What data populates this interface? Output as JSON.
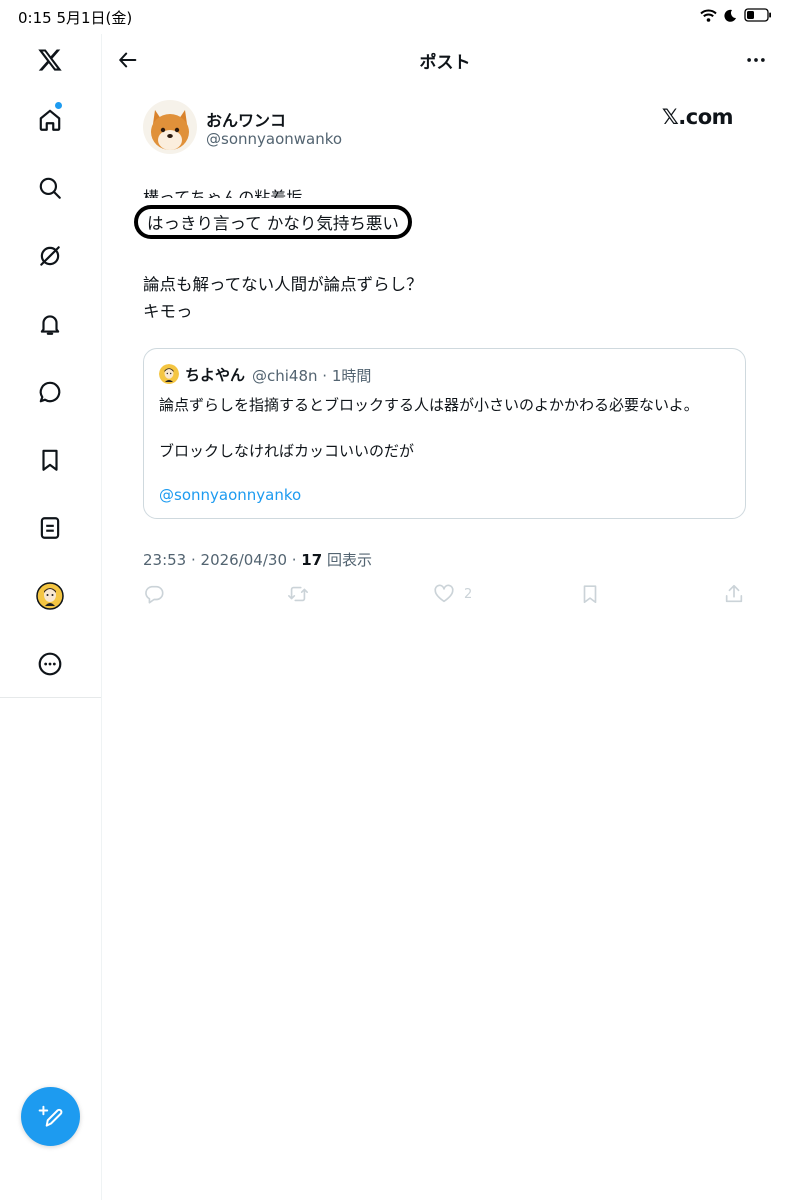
{
  "status_bar": {
    "time_date": "0:15   5月1日(金)"
  },
  "header": {
    "title": "ポスト"
  },
  "sidebar": {
    "icons": [
      "x-logo-icon",
      "home-icon",
      "search-icon",
      "grok-icon",
      "bell-icon",
      "messages-icon",
      "bookmark-icon",
      "lists-icon",
      "profile-avatar",
      "more-icon"
    ],
    "compose_icon": "compose-icon",
    "accent": "#1d9bf0"
  },
  "post": {
    "author_name": "おんワンコ",
    "author_handle": "@sonnyaonwanko",
    "watermark": "𝕏.com",
    "clipped_line": "構ってちゃんの粘着垢",
    "circled_line": "はっきり言って かなり気持ち悪い",
    "line_2": "論点も解ってない人間が論点ずらし？",
    "line_3": "キモっ",
    "quote": {
      "name": "ちよやん",
      "handle_time": "@chi48n · 1時間",
      "line_1": "論点ずらしを指摘するとブロックする人は器が小さいのよかかわる必要ないよ。",
      "line_2": "ブロックしなければカッコいいのだが",
      "mention": "@sonnyaonnyanko"
    },
    "timestamp": "23:53 · 2026/04/30 · ",
    "views_count": "17",
    "views_label": " 回表示",
    "likes_count": "2"
  }
}
